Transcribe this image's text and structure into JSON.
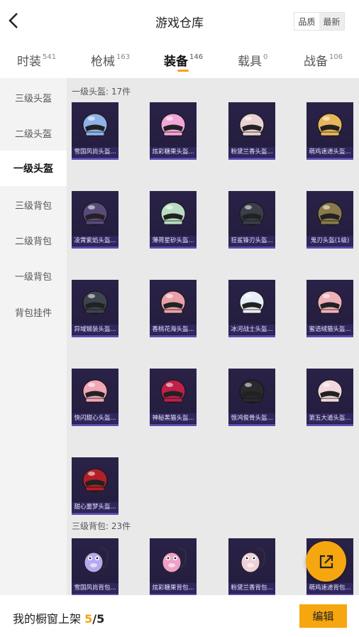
{
  "header": {
    "title": "游戏仓库",
    "sort_options": [
      "品质",
      "最新"
    ],
    "sort_active": "最新"
  },
  "tabs": [
    {
      "label": "时装",
      "count": "541"
    },
    {
      "label": "枪械",
      "count": "163"
    },
    {
      "label": "装备",
      "count": "146",
      "active": true
    },
    {
      "label": "载具",
      "count": "0"
    },
    {
      "label": "战备",
      "count": "106"
    }
  ],
  "sidebar": {
    "items": [
      {
        "label": "三级头盔"
      },
      {
        "label": "二级头盔"
      },
      {
        "label": "一级头盔",
        "active": true
      },
      {
        "label": "三级背包"
      },
      {
        "label": "二级背包"
      },
      {
        "label": "一级背包"
      },
      {
        "label": "背包挂件"
      }
    ]
  },
  "sections": [
    {
      "title": "一级头盔: 17件",
      "items": [
        {
          "name": "雪国风尚头盔...",
          "icon": "helmet-icon",
          "color": "#8fb3e8"
        },
        {
          "name": "炫彩糖果头盔...",
          "icon": "helmet-icon",
          "color": "#f2a6d8"
        },
        {
          "name": "粉黛兰香头盔...",
          "icon": "helmet-icon",
          "color": "#e8d2d2"
        },
        {
          "name": "萌鸡速递头盔...",
          "icon": "helmet-icon",
          "color": "#e8b65a"
        },
        {
          "name": "凌霄紫焰头盔...",
          "icon": "helmet-icon",
          "color": "#5a4a7a"
        },
        {
          "name": "薄荷星砂头盔...",
          "icon": "helmet-icon",
          "color": "#b9dcc2"
        },
        {
          "name": "狂鲨锋刃头盔...",
          "icon": "helmet-icon",
          "color": "#3a3f48"
        },
        {
          "name": "鬼刃头盔(1级)",
          "icon": "helmet-icon",
          "color": "#8a7a4a"
        },
        {
          "name": "异域锻装头盔...",
          "icon": "helmet-icon",
          "color": "#3d4550"
        },
        {
          "name": "香桃花海头盔...",
          "icon": "helmet-icon",
          "color": "#eaa0a8"
        },
        {
          "name": "冰河战士头盔...",
          "icon": "helmet-icon",
          "color": "#e8eef5"
        },
        {
          "name": "蜜语绒猫头盔...",
          "icon": "helmet-icon",
          "color": "#f0b0b8"
        },
        {
          "name": "快闪甜心头盔...",
          "icon": "helmet-icon",
          "color": "#f0a8b8"
        },
        {
          "name": "神秘黑猫头盔...",
          "icon": "helmet-icon",
          "color": "#c0204a"
        },
        {
          "name": "惊鸿俊骨头盔...",
          "icon": "helmet-icon",
          "color": "#2a2a2e"
        },
        {
          "name": "第五大道头盔...",
          "icon": "helmet-icon",
          "color": "#f2d8dc"
        },
        {
          "name": "甜心噩梦头盔...",
          "icon": "helmet-icon",
          "color": "#b0202a"
        }
      ]
    },
    {
      "title": "三级背包: 23件",
      "items": [
        {
          "name": "雪国风尚背包...",
          "icon": "backpack-icon",
          "color": "#b8a8f0"
        },
        {
          "name": "炫彩糖果背包...",
          "icon": "backpack-icon",
          "color": "#f0a0c8"
        },
        {
          "name": "粉黛兰香背包...",
          "icon": "backpack-icon",
          "color": "#f0d0d8"
        },
        {
          "name": "萌鸡速递背包...",
          "icon": "backpack-icon",
          "color": "#e8b65a"
        }
      ]
    }
  ],
  "footer": {
    "label": "我的橱窗上架",
    "count": "5",
    "total": "/5",
    "edit_label": "编辑"
  },
  "colors": {
    "accent": "#f6a60f",
    "card_bg": "#2a2247",
    "card_border": "#5b4ab0"
  }
}
